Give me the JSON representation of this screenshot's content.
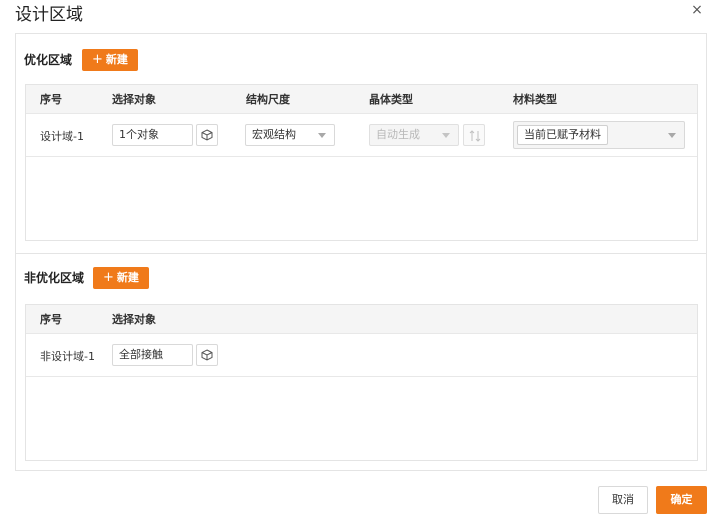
{
  "dialog": {
    "title": "设计区域",
    "close_icon": "close-icon",
    "close_glyph": "×"
  },
  "optimized": {
    "label": "优化区域",
    "new_button": "新建",
    "plus_glyph": "+",
    "columns": [
      "序号",
      "选择对象",
      "结构尺度",
      "晶体类型",
      "材料类型"
    ],
    "rows": [
      {
        "index": "设计域-1",
        "target": "1个对象",
        "scale": "宏观结构",
        "crystal": "自动生成",
        "crystal_disabled": true,
        "material_tag": "当前已赋予材料"
      }
    ]
  },
  "non_optimized": {
    "label": "非优化区域",
    "new_button": "新建",
    "plus_glyph": "+",
    "columns": [
      "序号",
      "选择对象"
    ],
    "rows": [
      {
        "index": "非设计域-1",
        "target": "全部接触"
      }
    ]
  },
  "footer": {
    "cancel": "取消",
    "ok": "确定"
  },
  "colors": {
    "accent": "#f07a1a",
    "header_bg": "#f5f5f5",
    "border": "#e4e4e4"
  },
  "icons": {
    "cube": "cube-icon",
    "swap": "swap-icon",
    "caret": "chevron-down-icon",
    "plus": "plus-icon"
  }
}
